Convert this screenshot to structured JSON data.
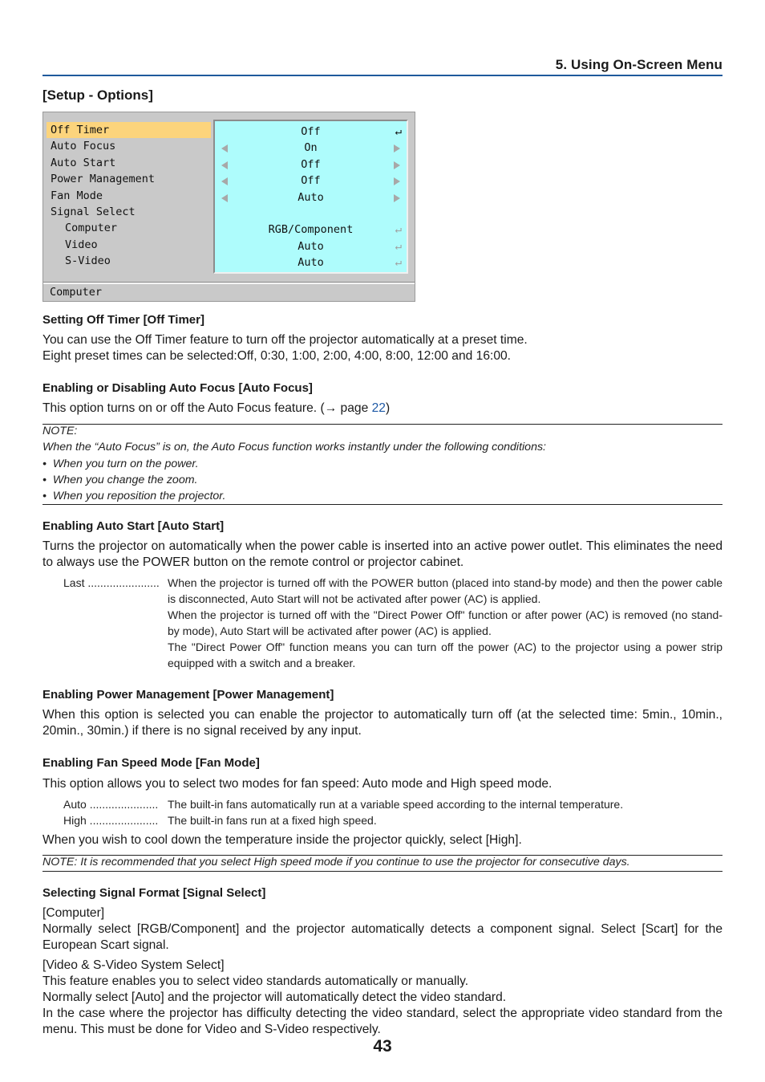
{
  "header": {
    "chapter": "5. Using On-Screen Menu",
    "section": "[Setup - Options]"
  },
  "osd_menu": {
    "items": [
      {
        "label": "Off Timer",
        "value": "Off",
        "control": "enter",
        "selected": true
      },
      {
        "label": "Auto Focus",
        "value": "On",
        "control": "arrows"
      },
      {
        "label": "Auto Start",
        "value": "Off",
        "control": "arrows"
      },
      {
        "label": "Power Management",
        "value": "Off",
        "control": "arrows"
      },
      {
        "label": "Fan Mode",
        "value": "Auto",
        "control": "arrows"
      },
      {
        "label": "Signal Select",
        "value": "",
        "control": "none"
      },
      {
        "label": "Computer",
        "value": "RGB/Component",
        "control": "enter-dim",
        "sub": true
      },
      {
        "label": "Video",
        "value": "Auto",
        "control": "enter-dim",
        "sub": true
      },
      {
        "label": "S-Video",
        "value": "Auto",
        "control": "enter-dim",
        "sub": true
      }
    ],
    "status": "Computer",
    "colors": {
      "selected": "#fcd47c",
      "value_panel": "#aefcfc",
      "panel": "#c9c9c9"
    }
  },
  "sections": {
    "off_timer": {
      "heading": "Setting Off Timer [Off Timer]",
      "line1": "You can use the Off Timer feature to turn off the projector automatically at a preset time.",
      "line2": "Eight preset times can be selected:Off, 0:30, 1:00, 2:00, 4:00, 8:00, 12:00 and 16:00."
    },
    "auto_focus": {
      "heading": "Enabling or Disabling Auto Focus [Auto Focus]",
      "text_before": "This option turns on or off the Auto Focus feature. (→ page ",
      "link": "22",
      "text_after": ")",
      "note": {
        "title": "NOTE:",
        "intro": "When the “Auto Focus” is on, the Auto Focus function works instantly under the following conditions:",
        "bullets": [
          "When you turn on the power.",
          "When you change the zoom.",
          "When you reposition the projector."
        ]
      }
    },
    "auto_start": {
      "heading": "Enabling Auto Start [Auto Start]",
      "text": "Turns the projector on automatically when the power cable is inserted into an active power outlet. This eliminates the need to always use the POWER button on the remote control or projector cabinet.",
      "term": "Last .......................",
      "desc1": "When the projector is turned off with the POWER button (placed into stand-by mode) and then the power cable is disconnected, Auto Start will not be activated after power (AC) is applied.",
      "desc2": "When the projector is turned off with the \"Direct Power Off\" function or after power (AC) is removed (no stand-by mode), Auto Start will be activated after power (AC) is applied.",
      "desc3": "The \"Direct Power Off\" function means you can turn off the power (AC) to the projector using a power strip equipped with a switch and a breaker."
    },
    "power_management": {
      "heading": "Enabling Power Management [Power Management]",
      "text": "When this option is selected you can enable the projector to automatically turn off (at the selected time: 5min., 10min., 20min., 30min.) if there is no signal received by any input."
    },
    "fan_mode": {
      "heading": "Enabling Fan Speed Mode [Fan Mode]",
      "text": "This option allows you to select two modes for fan speed: Auto mode and High speed mode.",
      "options": [
        {
          "term": "Auto ......................",
          "desc": "The built-in fans automatically run at a variable speed according to the internal temperature."
        },
        {
          "term": "High ......................",
          "desc": "The built-in fans run at a fixed high speed."
        }
      ],
      "after": "When you wish to cool down the temperature inside the projector quickly, select [High].",
      "note": "NOTE: It is recommended that you select High speed mode if you continue to use the projector for consecutive days."
    },
    "signal_select": {
      "heading": "Selecting Signal Format [Signal Select]",
      "computer_label": "[Computer]",
      "computer_text": "Normally select [RGB/Component] and the projector automatically detects a component signal. Select [Scart] for the European Scart signal.",
      "video_label": "[Video & S-Video System Select]",
      "video_line1": "This feature enables you to select video standards automatically or manually.",
      "video_line2": "Normally select [Auto] and the projector will automatically detect the video standard.",
      "video_line3": "In the case where the projector has difficulty detecting the video standard, select the appropriate video standard from the menu. This must be done for Video and S-Video respectively."
    }
  },
  "page_number": "43"
}
